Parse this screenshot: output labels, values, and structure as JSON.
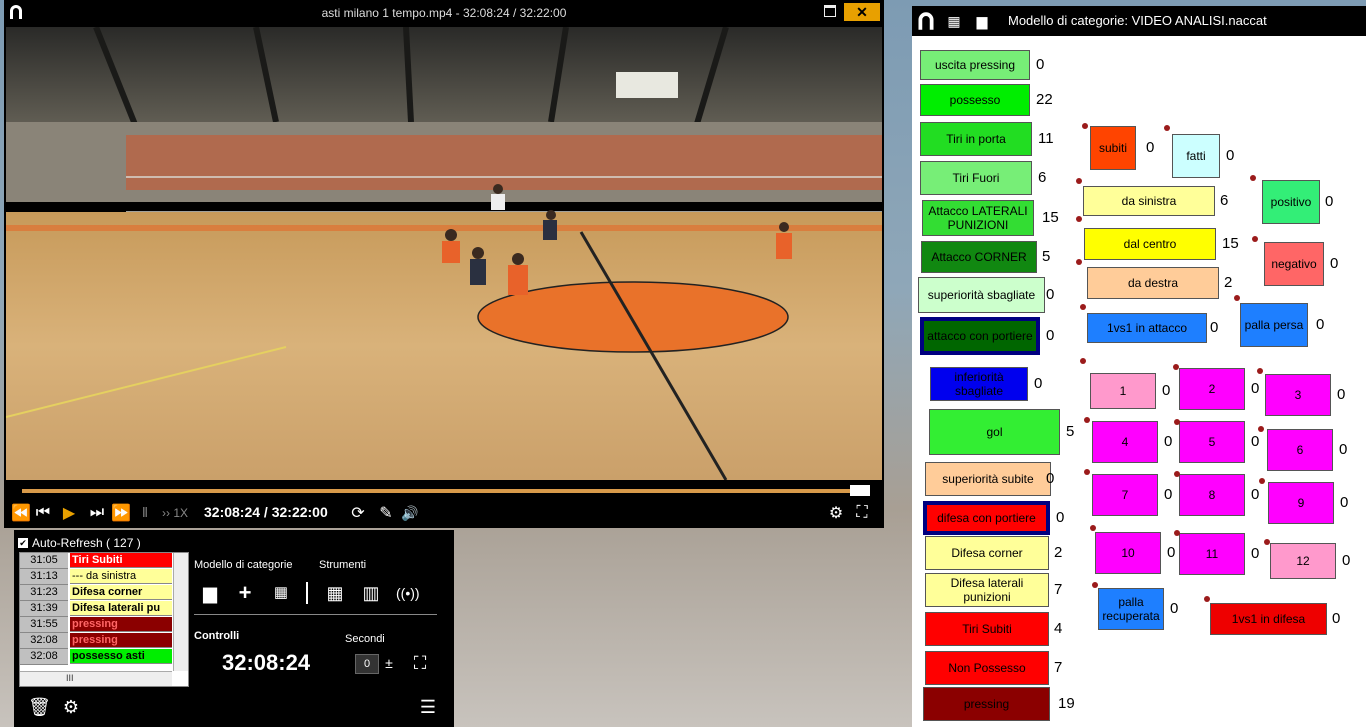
{
  "video": {
    "title": "asti milano 1 tempo.mp4 - 32:08:24 / 32:22:00",
    "close_label": "✕",
    "speed_label": "1X",
    "time_readout": "32:08:24 / 32:22:00",
    "progress_fraction": 0.979
  },
  "panel": {
    "auto_refresh": "Auto-Refresh ( 127 )",
    "events": [
      {
        "time": "31:05",
        "label": "Tiri Subiti",
        "bg": "#ff0000",
        "fg": "#ffffff"
      },
      {
        "time": "31:13",
        "label": "--- da sinistra",
        "bg": "#ffff99",
        "fg": "#000000"
      },
      {
        "time": "31:23",
        "label": "Difesa corner",
        "bg": "#ffff99",
        "fg": "#000000"
      },
      {
        "time": "31:39",
        "label": "Difesa laterali  pu",
        "bg": "#ffff99",
        "fg": "#000000"
      },
      {
        "time": "31:55",
        "label": "pressing",
        "bg": "#8b0000",
        "fg": "#ff6666"
      },
      {
        "time": "32:08",
        "label": "pressing",
        "bg": "#8b0000",
        "fg": "#ff6666"
      },
      {
        "time": "32:08",
        "label": "possesso asti",
        "bg": "#00ee00",
        "fg": "#000000"
      }
    ],
    "model_label": "Modello di categorie",
    "tools_label": "Strumenti",
    "controls_label": "Controlli",
    "seconds_label": "Secondi",
    "clock": "32:08:24",
    "seconds_value": "0",
    "hscroll_label": "III"
  },
  "categories": {
    "title": "Modello di categorie: VIDEO ANALISI.naccat",
    "left": [
      {
        "label": "uscita pressing",
        "count": "0",
        "bg": "#77ee77",
        "fg": "#000"
      },
      {
        "label": "possesso",
        "count": "22",
        "bg": "#00ee00",
        "fg": "#000"
      },
      {
        "label": "Tiri in porta",
        "count": "11",
        "bg": "#22dd22",
        "fg": "#000"
      },
      {
        "label": "Tiri Fuori",
        "count": "6",
        "bg": "#77ee77",
        "fg": "#000"
      },
      {
        "label": "Attacco LATERALI PUNIZIONI",
        "count": "15",
        "bg": "#33dd33",
        "fg": "#000"
      },
      {
        "label": "Attacco CORNER",
        "count": "5",
        "bg": "#118811",
        "fg": "#000"
      },
      {
        "label": "superiorità sbagliate",
        "count": "0",
        "bg": "#ccffcc",
        "fg": "#000"
      },
      {
        "label": "attacco con portiere",
        "count": "0",
        "bg": "#006600",
        "fg": "#000"
      },
      {
        "label": "inferiorità sbagliate",
        "count": "0",
        "bg": "#0000ee",
        "fg": "#000"
      },
      {
        "label": "gol",
        "count": "5",
        "bg": "#33ee33",
        "fg": "#000"
      },
      {
        "label": "superiorità subite",
        "count": "0",
        "bg": "#ffcc99",
        "fg": "#000"
      },
      {
        "label": "difesa con portiere",
        "count": "0",
        "bg": "#ff0000",
        "fg": "#000"
      },
      {
        "label": "Difesa corner",
        "count": "2",
        "bg": "#ffff99",
        "fg": "#000"
      },
      {
        "label": "Difesa laterali punizioni",
        "count": "7",
        "bg": "#ffff99",
        "fg": "#000"
      },
      {
        "label": "Tiri Subiti",
        "count": "4",
        "bg": "#ff0000",
        "fg": "#000"
      },
      {
        "label": "Non Possesso",
        "count": "7",
        "bg": "#ff0000",
        "fg": "#000"
      },
      {
        "label": "pressing",
        "count": "19",
        "bg": "#8b0000",
        "fg": "#000"
      }
    ],
    "mid": [
      {
        "label": "subiti",
        "count": "0",
        "bg": "#ff4400",
        "fg": "#000"
      },
      {
        "label": "fatti",
        "count": "0",
        "bg": "#ccffff",
        "fg": "#000"
      },
      {
        "label": "da sinistra",
        "count": "6",
        "bg": "#ffff99",
        "fg": "#000"
      },
      {
        "label": "positivo",
        "count": "0",
        "bg": "#33ee77",
        "fg": "#000"
      },
      {
        "label": "dal centro",
        "count": "15",
        "bg": "#ffff00",
        "fg": "#000"
      },
      {
        "label": "negativo",
        "count": "0",
        "bg": "#ff6666",
        "fg": "#000"
      },
      {
        "label": "da destra",
        "count": "2",
        "bg": "#ffcc99",
        "fg": "#000"
      },
      {
        "label": "1vs1 in attacco",
        "count": "0",
        "bg": "#1e7fff",
        "fg": "#000"
      },
      {
        "label": "palla persa",
        "count": "0",
        "bg": "#1e7fff",
        "fg": "#000"
      },
      {
        "label": "palla recuperata",
        "count": "0",
        "bg": "#1e7fff",
        "fg": "#000"
      },
      {
        "label": "1vs1 in difesa",
        "count": "0",
        "bg": "#ee0000",
        "fg": "#000"
      }
    ],
    "grid": [
      {
        "label": "1",
        "count": "0",
        "bg": "#ff99cc"
      },
      {
        "label": "2",
        "count": "0",
        "bg": "#ff00ff"
      },
      {
        "label": "3",
        "count": "0",
        "bg": "#ff00ff"
      },
      {
        "label": "4",
        "count": "0",
        "bg": "#ff00ff"
      },
      {
        "label": "5",
        "count": "0",
        "bg": "#ff00ff"
      },
      {
        "label": "6",
        "count": "0",
        "bg": "#ff00ff"
      },
      {
        "label": "7",
        "count": "0",
        "bg": "#ff00ff"
      },
      {
        "label": "8",
        "count": "0",
        "bg": "#ff00ff"
      },
      {
        "label": "9",
        "count": "0",
        "bg": "#ff00ff"
      },
      {
        "label": "10",
        "count": "0",
        "bg": "#ff00ff"
      },
      {
        "label": "11",
        "count": "0",
        "bg": "#ff00ff"
      },
      {
        "label": "12",
        "count": "0",
        "bg": "#ff99cc"
      }
    ]
  }
}
